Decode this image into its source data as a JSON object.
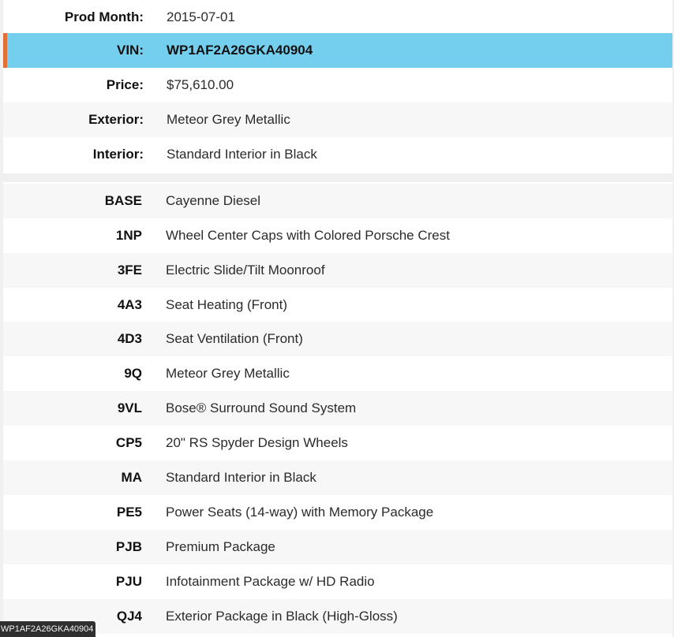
{
  "info": [
    {
      "label": "Prod Month:",
      "value": "2015-07-01"
    },
    {
      "label": "VIN:",
      "value": "WP1AF2A26GKA40904"
    },
    {
      "label": "Price:",
      "value": "$75,610.00"
    },
    {
      "label": "Exterior:",
      "value": "Meteor Grey Metallic"
    },
    {
      "label": "Interior:",
      "value": "Standard Interior in Black"
    }
  ],
  "options": [
    {
      "code": "BASE",
      "description": "Cayenne Diesel"
    },
    {
      "code": "1NP",
      "description": "Wheel Center Caps with Colored Porsche Crest"
    },
    {
      "code": "3FE",
      "description": "Electric Slide/Tilt Moonroof"
    },
    {
      "code": "4A3",
      "description": "Seat Heating (Front)"
    },
    {
      "code": "4D3",
      "description": "Seat Ventilation (Front)"
    },
    {
      "code": "9Q",
      "description": "Meteor Grey Metallic"
    },
    {
      "code": "9VL",
      "description": "Bose® Surround Sound System"
    },
    {
      "code": "CP5",
      "description": "20\" RS Spyder Design Wheels"
    },
    {
      "code": "MA",
      "description": "Standard Interior in Black"
    },
    {
      "code": "PE5",
      "description": "Power Seats (14-way) with Memory Package"
    },
    {
      "code": "PJB",
      "description": "Premium Package"
    },
    {
      "code": "PJU",
      "description": "Infotainment Package w/ HD Radio"
    },
    {
      "code": "QJ4",
      "description": "Exterior Package in Black (High-Gloss)"
    }
  ],
  "tooltip": {
    "text": "WP1AF2A26GKA40904"
  },
  "colors": {
    "highlight": "#74cfee",
    "accent": "#e0703a"
  }
}
